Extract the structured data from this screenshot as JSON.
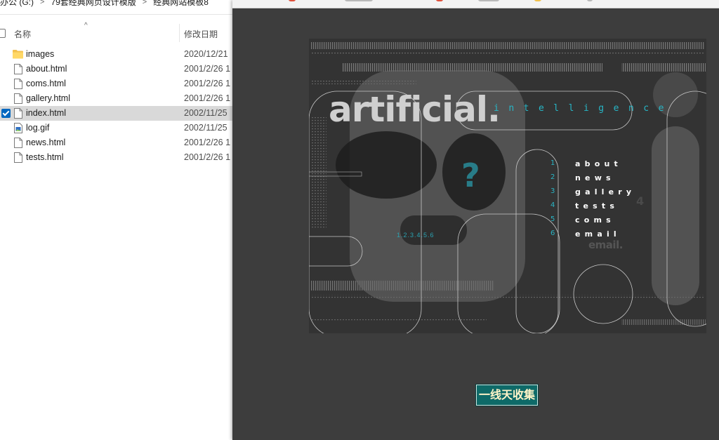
{
  "explorer": {
    "breadcrumb": [
      "办公 (G:)",
      "79套经典网页设计模版",
      "经典网站模板8"
    ],
    "columns": {
      "name": "名称",
      "date": "修改日期"
    },
    "files": [
      {
        "name": "images",
        "date": "2020/12/21",
        "type": "folder",
        "selected": false
      },
      {
        "name": "about.html",
        "date": "2001/2/26 1",
        "type": "file",
        "selected": false
      },
      {
        "name": "coms.html",
        "date": "2001/2/26 1",
        "type": "file",
        "selected": false
      },
      {
        "name": "gallery.html",
        "date": "2001/2/26 1",
        "type": "file",
        "selected": false
      },
      {
        "name": "index.html",
        "date": "2002/11/25",
        "type": "file",
        "selected": true
      },
      {
        "name": "log.gif",
        "date": "2002/11/25",
        "type": "image",
        "selected": false
      },
      {
        "name": "news.html",
        "date": "2001/2/26 1",
        "type": "file",
        "selected": false
      },
      {
        "name": "tests.html",
        "date": "2001/2/26 1",
        "type": "file",
        "selected": false
      }
    ]
  },
  "browser": {
    "banner": {
      "title": "artificial.",
      "subtitle": "intelligence",
      "mystery_icon": "?",
      "page_links": "1.2.3.4.5.6",
      "email_word": "email.",
      "small_mark": "4",
      "menu": [
        {
          "num": "1",
          "label": "about"
        },
        {
          "num": "2",
          "label": "news"
        },
        {
          "num": "3",
          "label": "gallery"
        },
        {
          "num": "4",
          "label": "tests"
        },
        {
          "num": "5",
          "label": "coms"
        },
        {
          "num": "6",
          "label": "email"
        }
      ]
    },
    "bottom_badge": "一线天收集"
  },
  "colors": {
    "accent_cyan": "#27b5c5",
    "browser_bg": "#3d3d3d",
    "banner_bg": "#333333",
    "selection": "#d9d9d9",
    "checkbox_blue": "#0067c0",
    "badge_bg": "#0e6a68"
  }
}
